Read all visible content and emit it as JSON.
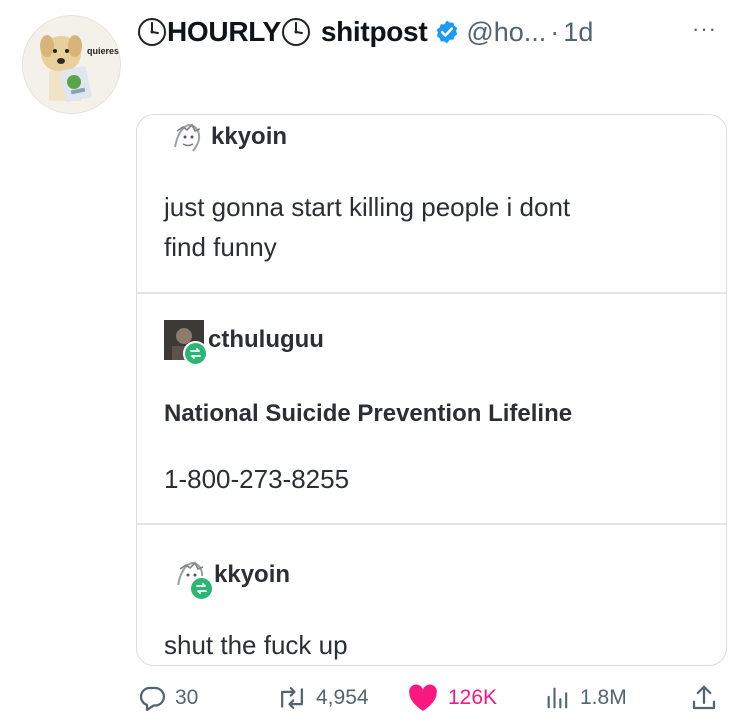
{
  "tweet": {
    "display_name_text": "HOURLY",
    "display_name_suffix": "shitpost",
    "handle": "@ho...",
    "separator": "·",
    "time": "1d",
    "more_label": "···",
    "avatar_caption": "quieres"
  },
  "quoted_posts": [
    {
      "username": "kkyoin",
      "text_lines": [
        "just gonna start killing people i dont",
        "find funny"
      ]
    },
    {
      "username": "cthuluguu",
      "heading": "National Suicide Prevention Lifeline",
      "text": "1-800-273-8255"
    },
    {
      "username": "kkyoin",
      "text": "shut the fuck up"
    }
  ],
  "actions": {
    "replies": "30",
    "reposts": "4,954",
    "likes": "126K",
    "views": "1.8M"
  },
  "colors": {
    "verified": "#1d9bf0",
    "like": "#f91880",
    "muted": "#536471",
    "reblog": "#2bb673"
  }
}
